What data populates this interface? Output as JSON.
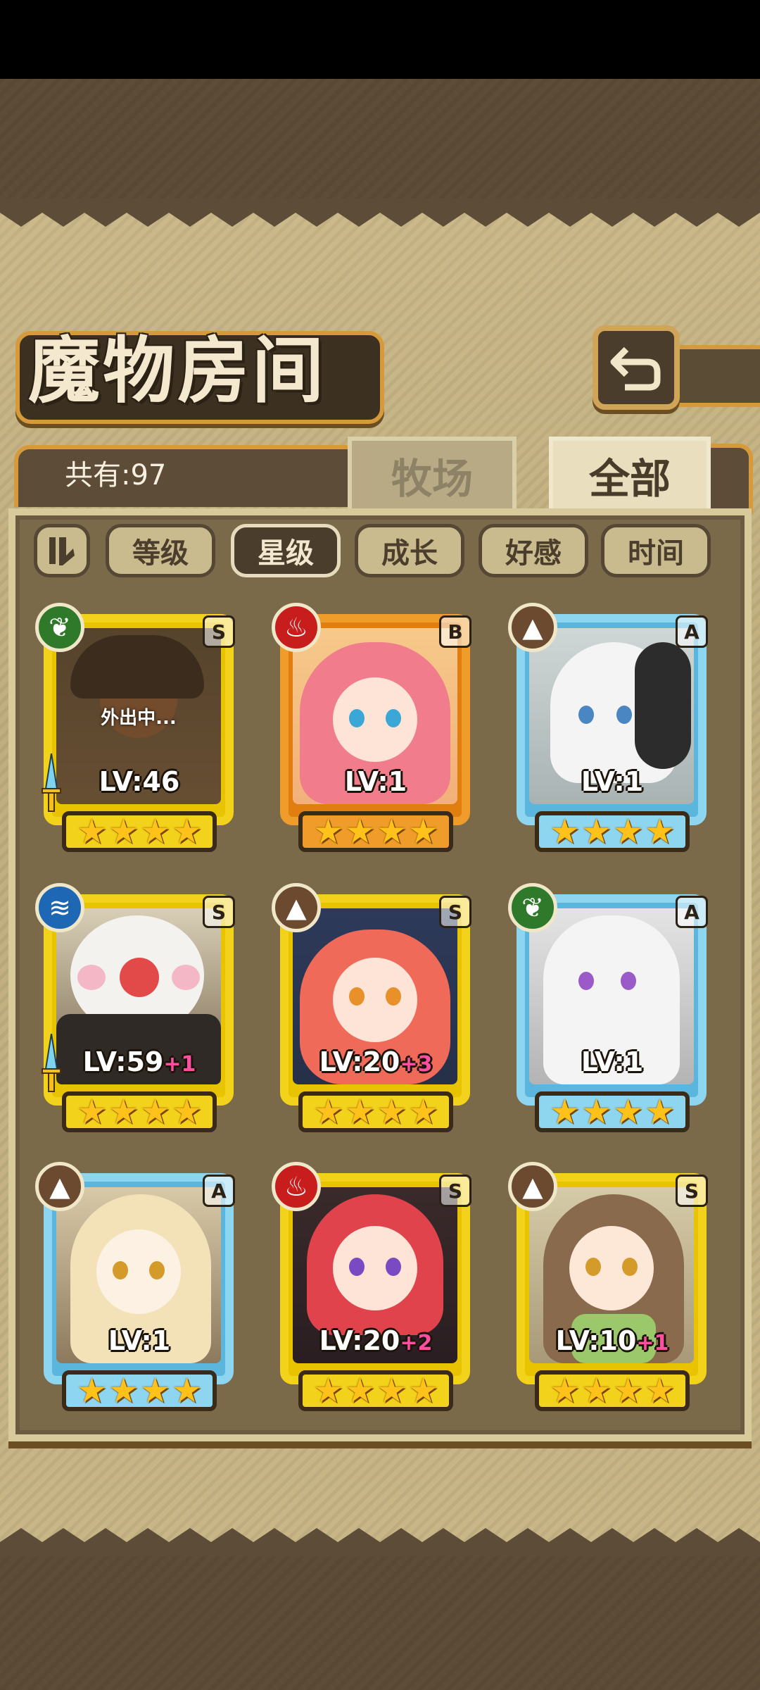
{
  "title": "魔物房间",
  "total_label": "共有:97",
  "tabs": [
    {
      "label": "牧场",
      "active": false
    },
    {
      "label": "全部",
      "active": true
    }
  ],
  "sort_buttons": [
    {
      "label": "等级",
      "active": false
    },
    {
      "label": "星级",
      "active": true
    },
    {
      "label": "成长",
      "active": false
    },
    {
      "label": "好感",
      "active": false
    },
    {
      "label": "时间",
      "active": false
    }
  ],
  "monsters": [
    {
      "rank": "S",
      "element": "grass",
      "level": "LV:46",
      "plus": "",
      "status": "外出中...",
      "frame": "gold",
      "stars": 4,
      "equipped_weapon": true
    },
    {
      "rank": "B",
      "element": "fire",
      "level": "LV:1",
      "plus": "",
      "status": "",
      "frame": "orange",
      "stars": 4,
      "equipped_weapon": false
    },
    {
      "rank": "A",
      "element": "earth",
      "level": "LV:1",
      "plus": "",
      "status": "",
      "frame": "blue",
      "stars": 4,
      "equipped_weapon": false
    },
    {
      "rank": "S",
      "element": "water",
      "level": "LV:59",
      "plus": "+1",
      "status": "",
      "frame": "gold",
      "stars": 4,
      "equipped_weapon": true
    },
    {
      "rank": "S",
      "element": "earth",
      "level": "LV:20",
      "plus": "+3",
      "status": "",
      "frame": "gold",
      "stars": 4,
      "equipped_weapon": false
    },
    {
      "rank": "A",
      "element": "grass",
      "level": "LV:1",
      "plus": "",
      "status": "",
      "frame": "blue",
      "stars": 4,
      "equipped_weapon": false
    },
    {
      "rank": "A",
      "element": "earth",
      "level": "LV:1",
      "plus": "",
      "status": "",
      "frame": "blue",
      "stars": 4,
      "equipped_weapon": false
    },
    {
      "rank": "S",
      "element": "fire",
      "level": "LV:20",
      "plus": "+2",
      "status": "",
      "frame": "gold",
      "stars": 4,
      "equipped_weapon": false
    },
    {
      "rank": "S",
      "element": "earth",
      "level": "LV:10",
      "plus": "+1",
      "status": "",
      "frame": "gold",
      "stars": 4,
      "equipped_weapon": false
    }
  ],
  "element_icons": {
    "grass": "leaf-icon",
    "fire": "flame-icon",
    "earth": "mountain-icon",
    "water": "wave-icon"
  }
}
